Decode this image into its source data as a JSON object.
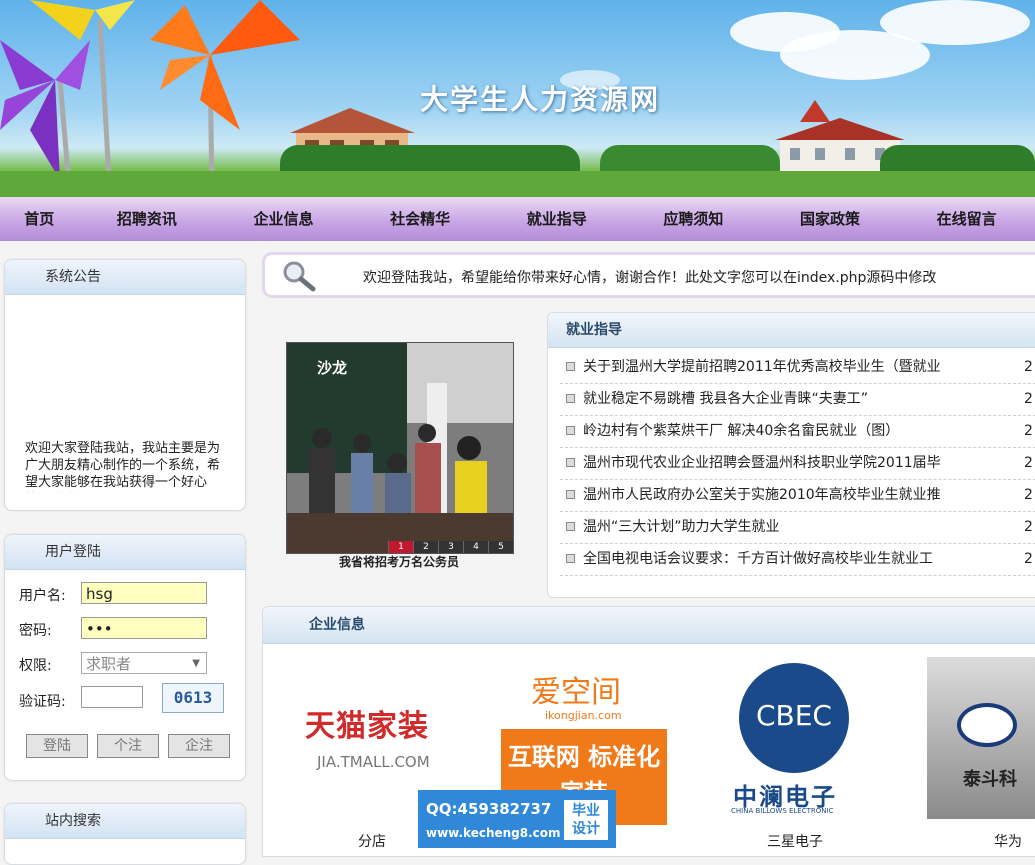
{
  "banner": {
    "site_title": "大学生人力资源网"
  },
  "nav": {
    "items": [
      "首页",
      "招聘资讯",
      "企业信息",
      "社会精华",
      "就业指导",
      "应聘须知",
      "国家政策",
      "在线留言"
    ]
  },
  "notice": {
    "title": "系统公告",
    "text": "欢迎大家登陆我站，我站主要是为广大朋友精心制作的一个系统，希望大家能够在我站获得一个好心情，谢谢！"
  },
  "login": {
    "title": "用户登陆",
    "username_label": "用户名:",
    "username_value": "hsg",
    "password_label": "密码:",
    "password_value": "•••",
    "role_label": "权限:",
    "role_value": "求职者",
    "captcha_label": "验证码:",
    "captcha_value": "",
    "captcha_code": "0613",
    "buttons": [
      "登陆",
      "个注",
      "企注"
    ]
  },
  "search": {
    "title": "站内搜索"
  },
  "marquee": {
    "text": "欢迎登陆我站，希望能给你带来好心情，谢谢合作！此处文字您可以在index.php源码中修改"
  },
  "career": {
    "title": "就业指导",
    "items": [
      {
        "title": "关于到温州大学提前招聘2011年优秀高校毕业生（暨就业",
        "date": "2"
      },
      {
        "title": "就业稳定不易跳槽 我县各大企业青睐“夫妻工”",
        "date": "2"
      },
      {
        "title": "岭边村有个紫菜烘干厂 解决40余名畲民就业（图）",
        "date": "2"
      },
      {
        "title": "温州市现代农业企业招聘会暨温州科技职业学院2011届毕",
        "date": "2"
      },
      {
        "title": "温州市人民政府办公室关于实施2010年高校毕业生就业推",
        "date": "2"
      },
      {
        "title": "温州“三大计划”助力大学生就业",
        "date": "2"
      },
      {
        "title": "全国电视电话会议要求：千方百计做好高校毕业生就业工",
        "date": "2"
      }
    ]
  },
  "slideshow": {
    "caption": "我省将招考万名公务员",
    "pages": [
      "1",
      "2",
      "3",
      "4",
      "5"
    ],
    "active_page": "1",
    "photo_text": "沙龙"
  },
  "company": {
    "title": "企业信息",
    "logos": [
      {
        "name": "分店",
        "logo_text": "天猫家装",
        "logo_sub": "JIA.TMALL.COM"
      },
      {
        "name": "",
        "logo_text": "爱空间",
        "logo_sub": "ikongjian.com",
        "logo_extra": "互联网 标准化家装"
      },
      {
        "name": "三星电子",
        "logo_text": "CBEC",
        "logo_sub": "中澜电子",
        "logo_extra": "CHINA BILLOWS ELECTRONIC"
      },
      {
        "name": "华为",
        "logo_text": "泰斗科",
        "logo_sub": ""
      }
    ]
  },
  "watermark": {
    "qq": "QQ:459382737",
    "url": "www.kecheng8.com",
    "tag_line1": "毕业",
    "tag_line2": "设计"
  },
  "colors": {
    "nav_bg": "#c9a6e5",
    "panel_head": "#d3e3f3",
    "input_bg": "#ffffbf",
    "watermark": "#2f88d8"
  }
}
